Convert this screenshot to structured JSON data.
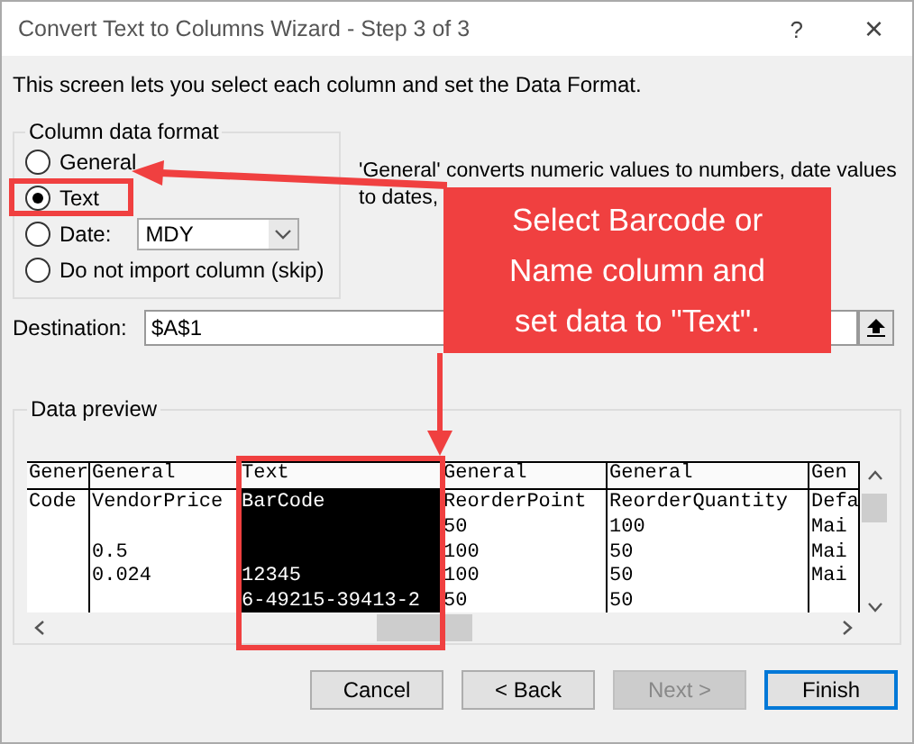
{
  "window": {
    "title": "Convert Text to Columns Wizard - Step 3 of 3",
    "help": "?",
    "close": "×"
  },
  "intro": "This screen lets you select each column and set the Data Format.",
  "format_group": {
    "label": "Column data format",
    "options": [
      {
        "kind": "plain",
        "label": "General",
        "selected": false
      },
      {
        "kind": "plain",
        "label": "Text",
        "selected": true
      },
      {
        "kind": "date",
        "label": "Date:",
        "selected": false,
        "value": "MDY"
      },
      {
        "kind": "plain",
        "label": "Do not import column (skip)",
        "selected": false
      }
    ]
  },
  "description": [
    "'General' converts numeric values to numbers, date values",
    "to dates,"
  ],
  "destination": {
    "label": "Destination:",
    "value": "$A$1"
  },
  "preview": {
    "label": "Data preview",
    "columns": [
      {
        "format": "Gener",
        "selected": false
      },
      {
        "format": "General",
        "selected": false
      },
      {
        "format": "Text",
        "selected": true
      },
      {
        "format": "General",
        "selected": false
      },
      {
        "format": "General",
        "selected": false
      },
      {
        "format": "Gen",
        "selected": false
      }
    ],
    "rows": [
      [
        "Code",
        "VendorPrice",
        "BarCode",
        "ReorderPoint",
        "ReorderQuantity",
        "Defa"
      ],
      [
        "",
        "",
        "",
        "50",
        "100",
        "Mai"
      ],
      [
        "",
        "0.5",
        "",
        "100",
        "50",
        "Mai"
      ],
      [
        "",
        "0.024",
        "12345",
        "100",
        "50",
        "Mai"
      ],
      [
        "",
        "",
        "6-49215-39413-2",
        "50",
        "50",
        ""
      ]
    ]
  },
  "buttons": [
    {
      "label": "Cancel",
      "disabled": false,
      "default": false
    },
    {
      "label": "< Back",
      "disabled": false,
      "default": false
    },
    {
      "label": "Next >",
      "disabled": true,
      "default": false
    },
    {
      "label": "Finish",
      "disabled": false,
      "default": true
    }
  ],
  "annotation": {
    "callout": [
      "Select Barcode or",
      "Name column and",
      "set data to \"Text\"."
    ]
  }
}
